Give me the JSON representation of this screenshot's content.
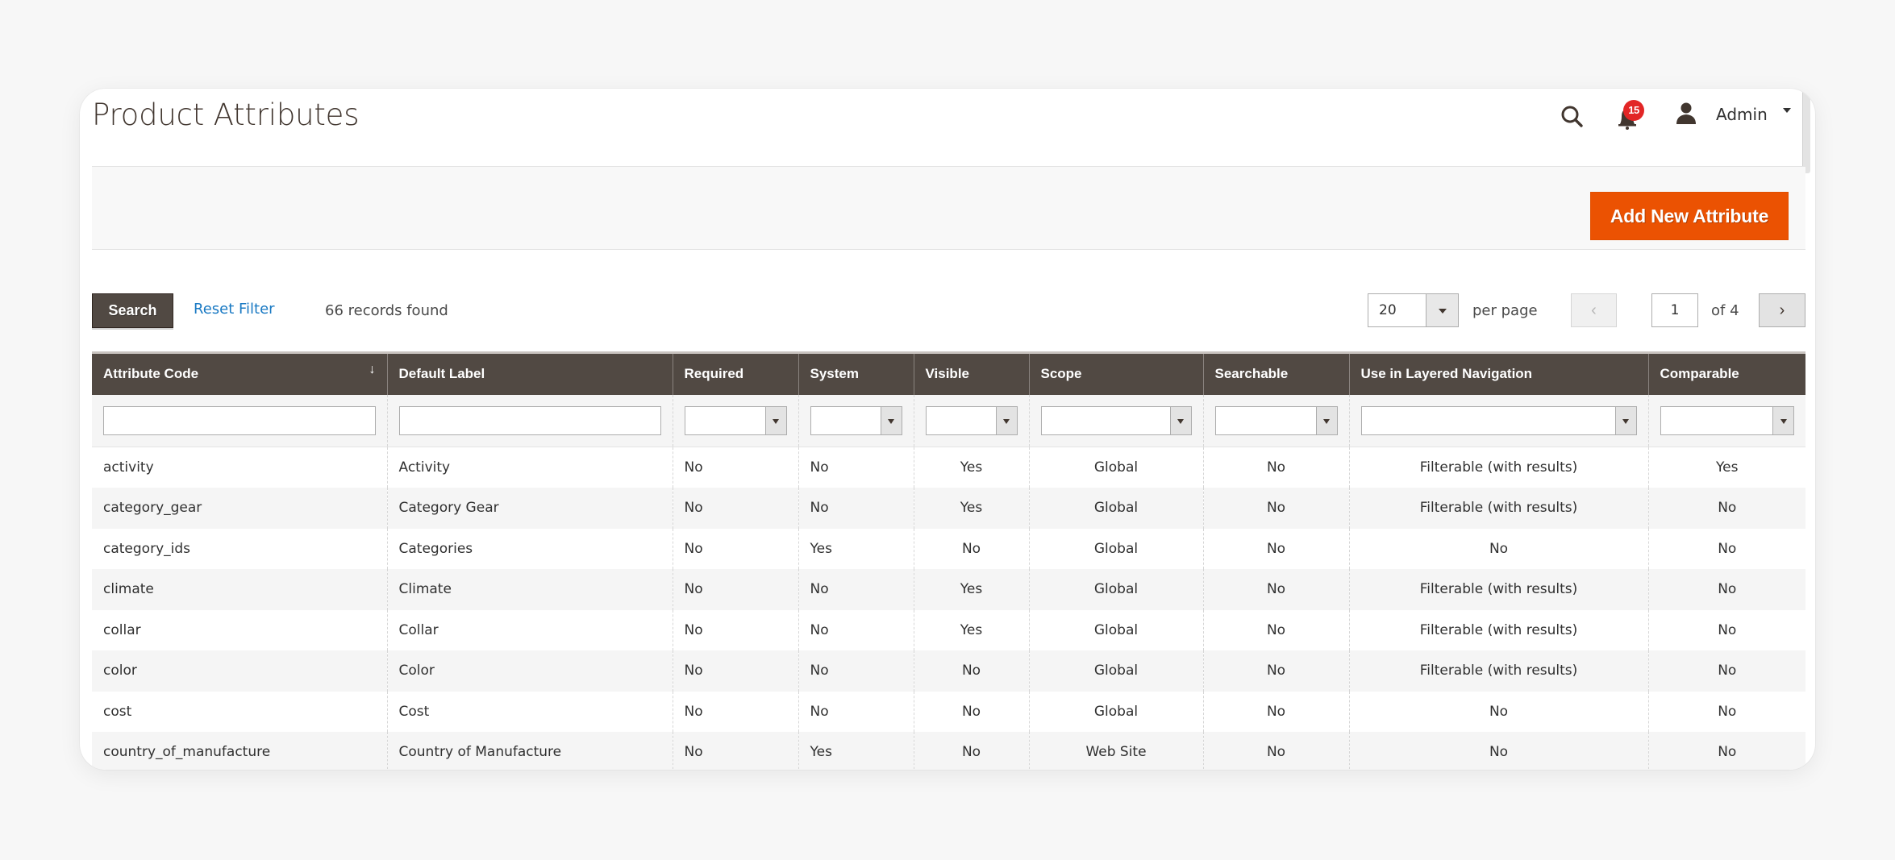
{
  "header": {
    "title": "Product Attributes",
    "notifications_count": "15",
    "user_name": "Admin"
  },
  "actions": {
    "add_new_label": "Add New Attribute"
  },
  "toolbar": {
    "search_label": "Search",
    "reset_label": "Reset Filter",
    "records_found": "66 records found",
    "per_page_value": "20",
    "per_page_label": "per page",
    "current_page": "1",
    "total_pages_label": "of 4",
    "prev_glyph": "‹",
    "next_glyph": "›"
  },
  "colors": {
    "accent": "#eb5202",
    "header_bg": "#514943",
    "link": "#1979c3",
    "badge": "#e22626"
  },
  "grid": {
    "sort_glyph": "↓",
    "columns": [
      {
        "label": "Attribute Code",
        "filter": "text"
      },
      {
        "label": "Default Label",
        "filter": "text"
      },
      {
        "label": "Required",
        "filter": "select"
      },
      {
        "label": "System",
        "filter": "select"
      },
      {
        "label": "Visible",
        "filter": "select"
      },
      {
        "label": "Scope",
        "filter": "select"
      },
      {
        "label": "Searchable",
        "filter": "select"
      },
      {
        "label": "Use in Layered Navigation",
        "filter": "select"
      },
      {
        "label": "Comparable",
        "filter": "select"
      }
    ],
    "rows": [
      [
        "activity",
        "Activity",
        "No",
        "No",
        "Yes",
        "Global",
        "No",
        "Filterable (with results)",
        "Yes"
      ],
      [
        "category_gear",
        "Category Gear",
        "No",
        "No",
        "Yes",
        "Global",
        "No",
        "Filterable (with results)",
        "No"
      ],
      [
        "category_ids",
        "Categories",
        "No",
        "Yes",
        "No",
        "Global",
        "No",
        "No",
        "No"
      ],
      [
        "climate",
        "Climate",
        "No",
        "No",
        "Yes",
        "Global",
        "No",
        "Filterable (with results)",
        "No"
      ],
      [
        "collar",
        "Collar",
        "No",
        "No",
        "Yes",
        "Global",
        "No",
        "Filterable (with results)",
        "No"
      ],
      [
        "color",
        "Color",
        "No",
        "No",
        "No",
        "Global",
        "No",
        "Filterable (with results)",
        "No"
      ],
      [
        "cost",
        "Cost",
        "No",
        "No",
        "No",
        "Global",
        "No",
        "No",
        "No"
      ],
      [
        "country_of_manufacture",
        "Country of Manufacture",
        "No",
        "Yes",
        "No",
        "Web Site",
        "No",
        "No",
        "No"
      ]
    ]
  }
}
